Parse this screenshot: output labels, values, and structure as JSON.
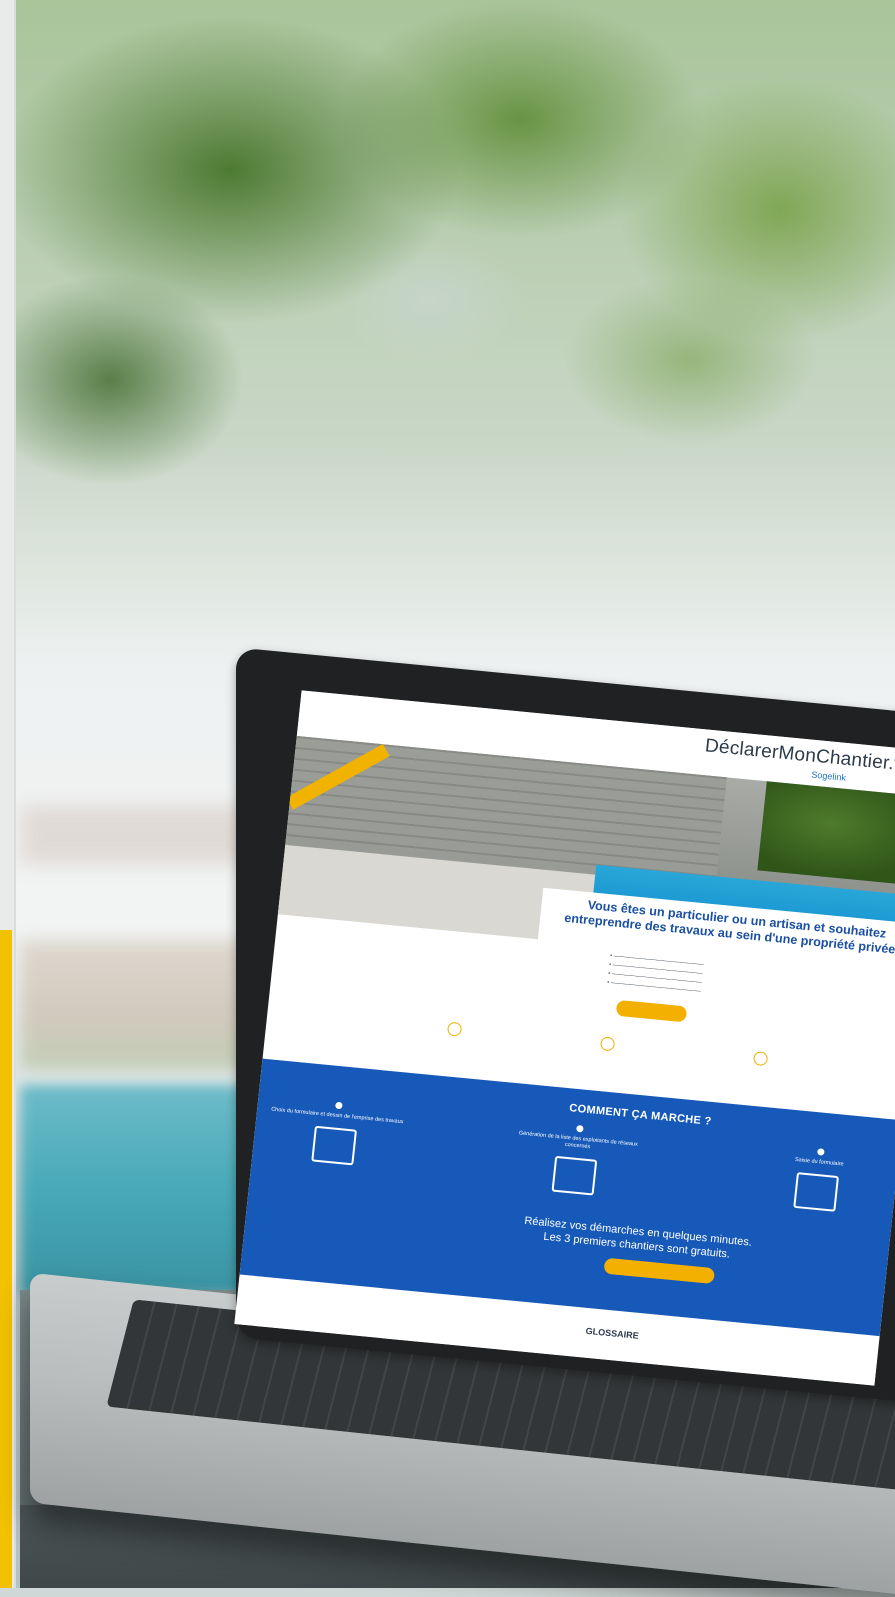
{
  "site": {
    "logo": "DéclarerMonChantier.fr",
    "logo_sub": "Sogelink",
    "hero_title": "Vous êtes un particulier ou un artisan et souhaitez entreprendre des travaux au sein d'une propriété privée ?",
    "section_title": "COMMENT ÇA MARCHE ?",
    "steps": [
      {
        "label": "Choix du formulaire et dessin de l'emprise des travaux"
      },
      {
        "label": "Génération de la liste des exploitants de réseaux concernés"
      },
      {
        "label": "Saisie du formulaire"
      }
    ],
    "tagline_1": "Réalisez vos démarches en quelques minutes.",
    "tagline_2": "Les 3 premiers chantiers sont gratuits.",
    "footer_heading": "GLOSSAIRE"
  },
  "colors": {
    "brand_blue": "#1659b8",
    "accent_yellow": "#f4b000",
    "side_stripe": "#f2c200"
  }
}
